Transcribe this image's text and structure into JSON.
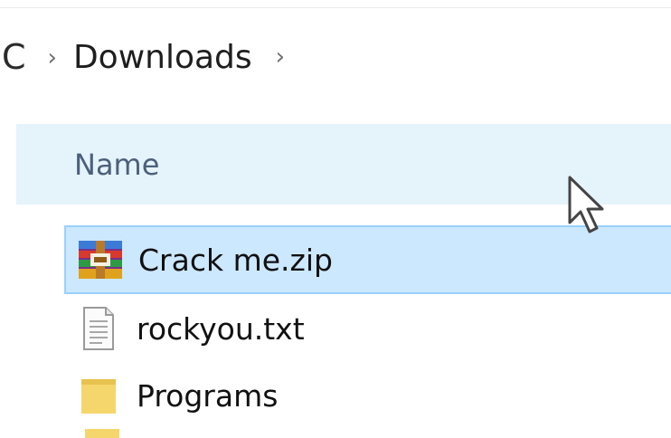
{
  "breadcrumb": {
    "root": "C",
    "separator": "›",
    "items": [
      "Downloads"
    ],
    "trailing_chevron": "›"
  },
  "header": {
    "name_label": "Name"
  },
  "files": [
    {
      "name": "Crack me.zip",
      "icon": "winrar-archive-icon",
      "selected": true
    },
    {
      "name": "rockyou.txt",
      "icon": "text-file-icon",
      "selected": false
    },
    {
      "name": "Programs",
      "icon": "folder-icon",
      "selected": false
    }
  ],
  "colors": {
    "header_bg": "#e5f3fb",
    "selection_bg": "#cce8ff",
    "selection_border": "#99d1ff",
    "folder": "#f5d66c"
  }
}
